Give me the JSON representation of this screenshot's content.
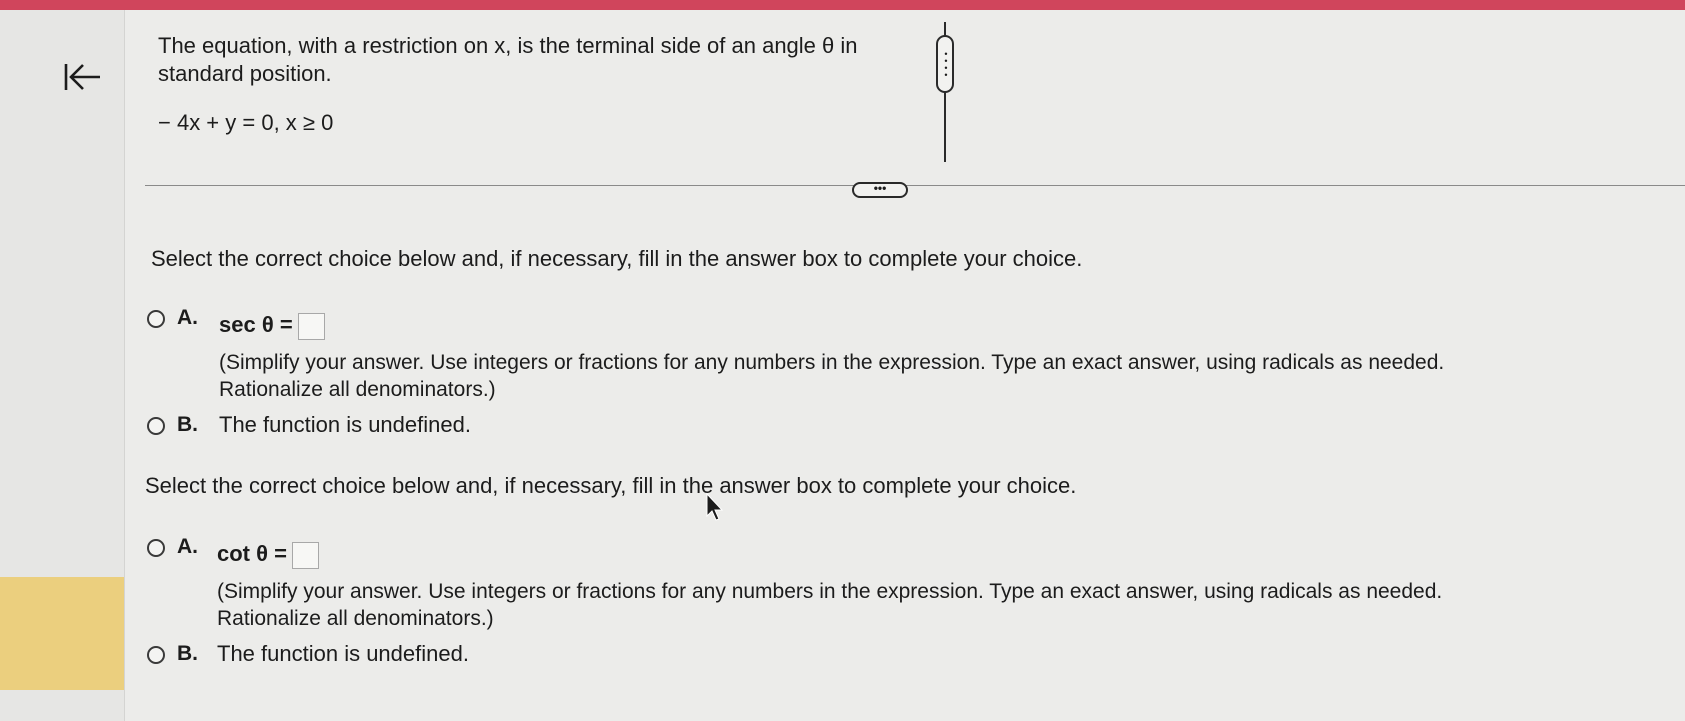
{
  "nav": {
    "back_icon": "collapse-left-arrow-icon"
  },
  "question": {
    "text": "The equation, with a restriction on x, is the terminal side of an angle θ in standard position.",
    "equation": "− 4x + y = 0, x ≥ 0"
  },
  "parts": [
    {
      "instruction": "Select the correct choice below and, if necessary, fill in the answer box to complete your choice.",
      "option_a": {
        "letter": "A.",
        "expr": "sec θ =",
        "hint": "(Simplify your answer. Use integers or fractions for any numbers in the expression. Type an exact answer, using radicals as needed. Rationalize all denominators.)"
      },
      "option_b": {
        "letter": "B.",
        "text": "The function is undefined."
      }
    },
    {
      "instruction": "Select the correct choice below and, if necessary, fill in the answer box to complete your choice.",
      "option_a": {
        "letter": "A.",
        "expr": "cot θ =",
        "hint": "(Simplify your answer. Use integers or fractions for any numbers in the expression. Type an exact answer, using radicals as needed. Rationalize all denominators.)"
      },
      "option_b": {
        "letter": "B.",
        "text": "The function is undefined."
      }
    }
  ],
  "colors": {
    "top_bar": "#d0455c",
    "side_band": "#ebcf7e",
    "background": "#ececea"
  }
}
